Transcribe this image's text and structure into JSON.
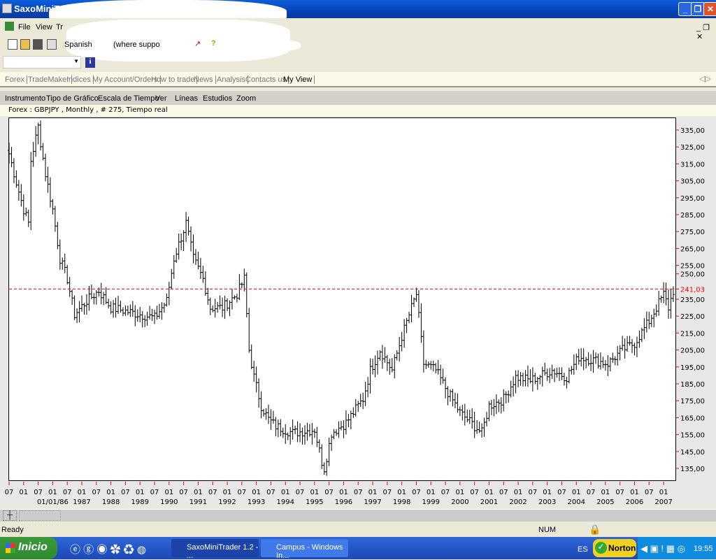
{
  "window": {
    "title": "SaxoMiniT",
    "controls": [
      "_",
      "❐",
      "✕"
    ]
  },
  "menu": [
    "File",
    "View",
    "Tr"
  ],
  "toolbar": {
    "language": "Spanish",
    "hint": "(where suppo"
  },
  "tabs": [
    "Forex",
    "TradeMaker",
    "Indices",
    "My Account/Orders",
    "How to trade",
    "News",
    "Analysis",
    "Contacts us",
    "My View"
  ],
  "chart_menu": [
    "Instrumento",
    "Tipo de Gráfico",
    "Escala de Tiempo",
    "Ver",
    "Líneas",
    "Estudios",
    "Zoom"
  ],
  "chart_info": "Forex : GBPJPY , Monthly , # 275, Tiempo real",
  "status": {
    "ready": "Ready",
    "num": "NUM"
  },
  "taskbar": {
    "start": "Inicio",
    "tasks": [
      "SaxoMiniTrader 1.2 - ...",
      "Campus - Windows In..."
    ],
    "lang": "ES",
    "norton": "Norton",
    "clock": "19:55"
  },
  "chart_data": {
    "type": "ohlc",
    "instrument": "GBPJPY",
    "timeframe": "Monthly",
    "bars": 275,
    "start_month": "1984-07",
    "ylim": [
      130,
      340
    ],
    "yticks": [
      335,
      325,
      315,
      305,
      295,
      285,
      275,
      265,
      255,
      250,
      235,
      225,
      215,
      205,
      195,
      185,
      175,
      165,
      155,
      145,
      135
    ],
    "ytick_labels": [
      "335,00",
      "325,00",
      "315,00",
      "305,00",
      "295,00",
      "285,00",
      "275,00",
      "265,00",
      "255,00",
      "250,00",
      "235,00",
      "225,00",
      "215,00",
      "205,00",
      "195,00",
      "185,00",
      "175,00",
      "165,00",
      "155,00",
      "145,00",
      "135,00"
    ],
    "hline": {
      "value": 241.03,
      "label": "241,03",
      "color": "#ff0000"
    },
    "year_labels": [
      "01/01/86",
      "1987",
      "1988",
      "1989",
      "1990",
      "1991",
      "1992",
      "1993",
      "1994",
      "1995",
      "1996",
      "1997",
      "1998",
      "1999",
      "2000",
      "2001",
      "2002",
      "2003",
      "2004",
      "2005",
      "2006",
      "2007"
    ],
    "close_anchors": [
      [
        0,
        321
      ],
      [
        3,
        304
      ],
      [
        6,
        288
      ],
      [
        8,
        280
      ],
      [
        9,
        317
      ],
      [
        12,
        337
      ],
      [
        15,
        309
      ],
      [
        18,
        288
      ],
      [
        21,
        259
      ],
      [
        24,
        247
      ],
      [
        27,
        226
      ],
      [
        32,
        234
      ],
      [
        37,
        240
      ],
      [
        42,
        230
      ],
      [
        54,
        226
      ],
      [
        60,
        224
      ],
      [
        65,
        234
      ],
      [
        68,
        259
      ],
      [
        73,
        280
      ],
      [
        76,
        259
      ],
      [
        80,
        247
      ],
      [
        83,
        230
      ],
      [
        88,
        230
      ],
      [
        94,
        238
      ],
      [
        97,
        247
      ],
      [
        99,
        205
      ],
      [
        101,
        189
      ],
      [
        104,
        172
      ],
      [
        107,
        164
      ],
      [
        110,
        160
      ],
      [
        117,
        156
      ],
      [
        126,
        158
      ],
      [
        129,
        139
      ],
      [
        130,
        135
      ],
      [
        133,
        156
      ],
      [
        139,
        162
      ],
      [
        146,
        176
      ],
      [
        149,
        193
      ],
      [
        153,
        205
      ],
      [
        158,
        193
      ],
      [
        162,
        213
      ],
      [
        166,
        230
      ],
      [
        168,
        238
      ],
      [
        171,
        197
      ],
      [
        176,
        193
      ],
      [
        181,
        180
      ],
      [
        186,
        168
      ],
      [
        192,
        160
      ],
      [
        195,
        156
      ],
      [
        198,
        172
      ],
      [
        204,
        176
      ],
      [
        209,
        189
      ],
      [
        215,
        187
      ],
      [
        224,
        193
      ],
      [
        230,
        189
      ],
      [
        235,
        201
      ],
      [
        241,
        199
      ],
      [
        247,
        197
      ],
      [
        253,
        205
      ],
      [
        258,
        209
      ],
      [
        264,
        222
      ],
      [
        270,
        238
      ],
      [
        272,
        230
      ],
      [
        274,
        240
      ]
    ]
  }
}
